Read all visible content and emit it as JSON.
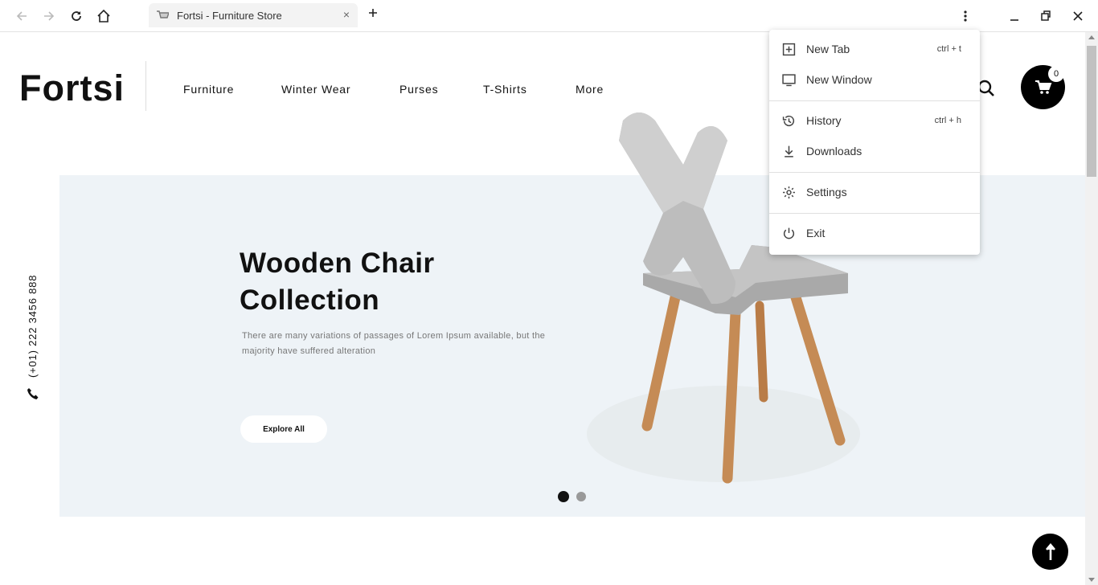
{
  "browser": {
    "tab_title": "Fortsi - Furniture Store",
    "tab_close": "×",
    "new_tab": "+"
  },
  "site": {
    "logo": "Fortsi",
    "nav": [
      "Furniture",
      "Winter Wear",
      "Purses",
      "T-Shirts",
      "More"
    ],
    "cart_count": "0",
    "phone": "(+01) 222 3456 888"
  },
  "hero": {
    "title_line1": "Wooden Chair",
    "title_line2": "Collection",
    "description": "There are many variations of passages of Lorem Ipsum available, but the majority have suffered alteration",
    "button": "Explore All",
    "slide_count": 2,
    "active_slide": 1
  },
  "menu": {
    "items": [
      {
        "label": "New Tab",
        "shortcut": "ctrl + t",
        "icon": "plus-box-icon"
      },
      {
        "label": "New Window",
        "shortcut": "",
        "icon": "monitor-icon"
      },
      {
        "label": "History",
        "shortcut": "ctrl + h",
        "icon": "history-icon"
      },
      {
        "label": "Downloads",
        "shortcut": "",
        "icon": "download-icon"
      },
      {
        "label": "Settings",
        "shortcut": "",
        "icon": "gear-icon"
      },
      {
        "label": "Exit",
        "shortcut": "",
        "icon": "power-icon"
      }
    ]
  },
  "colors": {
    "hero_bg": "#eef3f7",
    "accent": "#000000"
  }
}
